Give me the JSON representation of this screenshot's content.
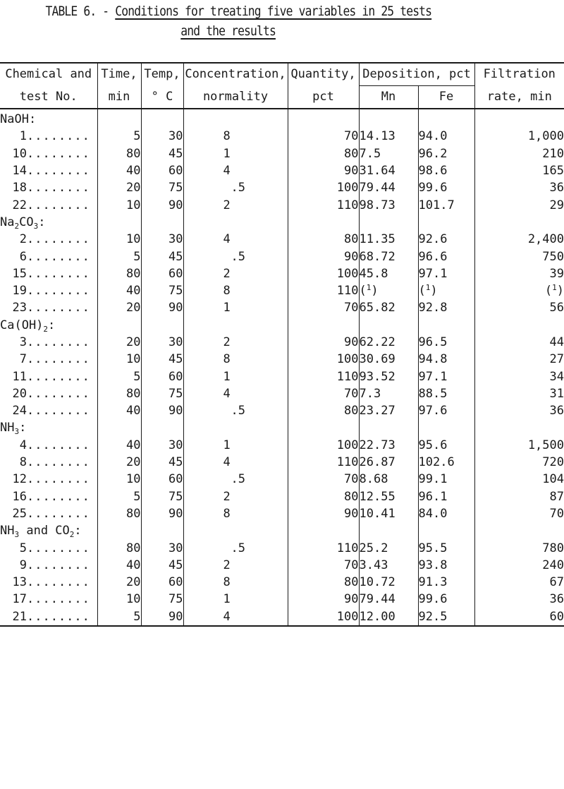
{
  "title": {
    "prefix": "TABLE 6. - ",
    "line1": "Conditions for treating five variables in 25 tests",
    "line2": "and the results"
  },
  "headers": {
    "chemical_line1": "Chemical and",
    "chemical_line2": "test No.",
    "time_line1": "Time,",
    "time_line2": "min",
    "temp_line1": "Temp,",
    "temp_line2": "° C",
    "conc_line1": "Concentration,",
    "conc_line2": "normality",
    "qty_line1": "Quantity,",
    "qty_line2": "pct",
    "deposition": "Deposition, pct",
    "mn": "Mn",
    "fe": "Fe",
    "filt_line1": "Filtration",
    "filt_line2": "rate, min"
  },
  "groups": [
    {
      "name": "NaOH",
      "name_parts": [
        [
          "NaOH",
          ""
        ]
      ],
      "rows": [
        {
          "test": "1",
          "time": "5",
          "temp": "30",
          "conc": "8",
          "qty": "70",
          "mn": "14.13",
          "fe": "94.0",
          "filt": "1,000"
        },
        {
          "test": "10",
          "time": "80",
          "temp": "45",
          "conc": "1",
          "qty": "80",
          "mn": "7.5",
          "fe": "96.2",
          "filt": "210"
        },
        {
          "test": "14",
          "time": "40",
          "temp": "60",
          "conc": "4",
          "qty": "90",
          "mn": "31.64",
          "fe": "98.6",
          "filt": "165"
        },
        {
          "test": "18",
          "time": "20",
          "temp": "75",
          "conc": ".5",
          "qty": "100",
          "mn": "79.44",
          "fe": "99.6",
          "filt": "36"
        },
        {
          "test": "22",
          "time": "10",
          "temp": "90",
          "conc": "2",
          "qty": "110",
          "mn": "98.73",
          "fe": "101.7",
          "filt": "29"
        }
      ]
    },
    {
      "name": "Na2CO3",
      "name_parts": [
        [
          "Na",
          "2"
        ],
        [
          "CO",
          "3"
        ]
      ],
      "rows": [
        {
          "test": "2",
          "time": "10",
          "temp": "30",
          "conc": "4",
          "qty": "80",
          "mn": "11.35",
          "fe": "92.6",
          "filt": "2,400"
        },
        {
          "test": "6",
          "time": "5",
          "temp": "45",
          "conc": ".5",
          "qty": "90",
          "mn": "68.72",
          "fe": "96.6",
          "filt": "750"
        },
        {
          "test": "15",
          "time": "80",
          "temp": "60",
          "conc": "2",
          "qty": "100",
          "mn": "45.8",
          "fe": "97.1",
          "filt": "39"
        },
        {
          "test": "19",
          "time": "40",
          "temp": "75",
          "conc": "8",
          "qty": "110",
          "mn": "(1)",
          "fe": "(1)",
          "filt": "(1)"
        },
        {
          "test": "23",
          "time": "20",
          "temp": "90",
          "conc": "1",
          "qty": "70",
          "mn": "65.82",
          "fe": "92.8",
          "filt": "56"
        }
      ]
    },
    {
      "name": "Ca(OH)2",
      "name_parts": [
        [
          "Ca(OH)",
          "2"
        ]
      ],
      "rows": [
        {
          "test": "3",
          "time": "20",
          "temp": "30",
          "conc": "2",
          "qty": "90",
          "mn": "62.22",
          "fe": "96.5",
          "filt": "44"
        },
        {
          "test": "7",
          "time": "10",
          "temp": "45",
          "conc": "8",
          "qty": "100",
          "mn": "30.69",
          "fe": "94.8",
          "filt": "27"
        },
        {
          "test": "11",
          "time": "5",
          "temp": "60",
          "conc": "1",
          "qty": "110",
          "mn": "93.52",
          "fe": "97.1",
          "filt": "34"
        },
        {
          "test": "20",
          "time": "80",
          "temp": "75",
          "conc": "4",
          "qty": "70",
          "mn": "7.3",
          "fe": "88.5",
          "filt": "31"
        },
        {
          "test": "24",
          "time": "40",
          "temp": "90",
          "conc": ".5",
          "qty": "80",
          "mn": "23.27",
          "fe": "97.6",
          "filt": "36"
        }
      ]
    },
    {
      "name": "NH3",
      "name_parts": [
        [
          "NH",
          "3"
        ]
      ],
      "rows": [
        {
          "test": "4",
          "time": "40",
          "temp": "30",
          "conc": "1",
          "qty": "100",
          "mn": "22.73",
          "fe": "95.6",
          "filt": "1,500"
        },
        {
          "test": "8",
          "time": "20",
          "temp": "45",
          "conc": "4",
          "qty": "110",
          "mn": "26.87",
          "fe": "102.6",
          "filt": "720"
        },
        {
          "test": "12",
          "time": "10",
          "temp": "60",
          "conc": ".5",
          "qty": "70",
          "mn": "8.68",
          "fe": "99.1",
          "filt": "104"
        },
        {
          "test": "16",
          "time": "5",
          "temp": "75",
          "conc": "2",
          "qty": "80",
          "mn": "12.55",
          "fe": "96.1",
          "filt": "87"
        },
        {
          "test": "25",
          "time": "80",
          "temp": "90",
          "conc": "8",
          "qty": "90",
          "mn": "10.41",
          "fe": "84.0",
          "filt": "70"
        }
      ]
    },
    {
      "name": "NH3 and CO2",
      "name_parts": [
        [
          "NH",
          "3"
        ],
        [
          " and CO",
          "2"
        ]
      ],
      "rows": [
        {
          "test": "5",
          "time": "80",
          "temp": "30",
          "conc": ".5",
          "qty": "110",
          "mn": "25.2",
          "fe": "95.5",
          "filt": "780"
        },
        {
          "test": "9",
          "time": "40",
          "temp": "45",
          "conc": "2",
          "qty": "70",
          "mn": "3.43",
          "fe": "93.8",
          "filt": "240"
        },
        {
          "test": "13",
          "time": "20",
          "temp": "60",
          "conc": "8",
          "qty": "80",
          "mn": "10.72",
          "fe": "91.3",
          "filt": "67"
        },
        {
          "test": "17",
          "time": "10",
          "temp": "75",
          "conc": "1",
          "qty": "90",
          "mn": "79.44",
          "fe": "99.6",
          "filt": "36"
        },
        {
          "test": "21",
          "time": "5",
          "temp": "90",
          "conc": "4",
          "qty": "100",
          "mn": "12.00",
          "fe": "92.5",
          "filt": "60"
        }
      ]
    }
  ],
  "leader_dots": "........",
  "group_suffix": ":"
}
